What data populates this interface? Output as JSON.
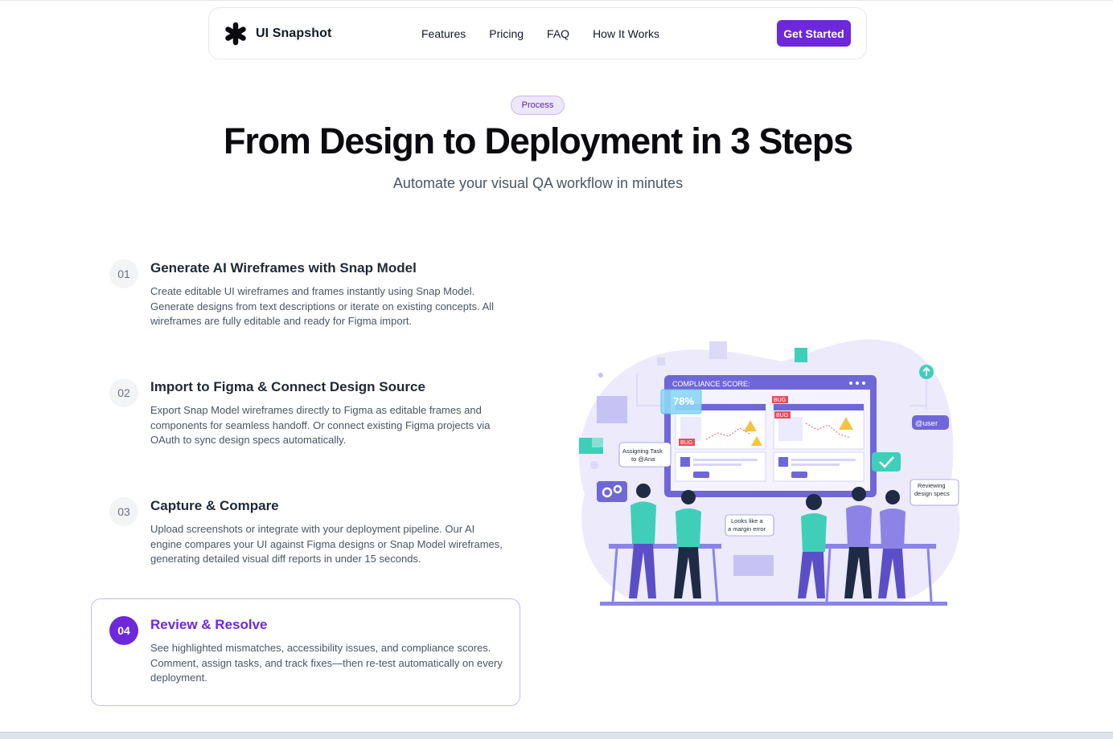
{
  "nav": {
    "brand": "UI Snapshot",
    "links": [
      "Features",
      "Pricing",
      "FAQ",
      "How It Works"
    ],
    "cta": "Get Started"
  },
  "hero": {
    "badge": "Process",
    "title": "From Design to Deployment in 3 Steps",
    "subtitle": "Automate your visual QA workflow in minutes"
  },
  "steps": [
    {
      "num": "01",
      "title": "Generate AI Wireframes with Snap Model",
      "desc": "Create editable UI wireframes and frames instantly using Snap Model. Generate designs from text descriptions or iterate on existing concepts. All wireframes are fully editable and ready for Figma import."
    },
    {
      "num": "02",
      "title": "Import to Figma & Connect Design Source",
      "desc": "Export Snap Model wireframes directly to Figma as editable frames and components for seamless handoff. Or connect existing Figma projects via OAuth to sync design specs automatically."
    },
    {
      "num": "03",
      "title": "Capture & Compare",
      "desc": "Upload screenshots or integrate with your deployment pipeline. Our AI engine compares your UI against Figma designs or Snap Model wireframes, generating detailed visual diff reports in under 15 seconds."
    },
    {
      "num": "04",
      "title": "Review & Resolve",
      "desc": "See highlighted mismatches, accessibility issues, and compliance scores. Comment, assign tasks, and track fixes—then re-test automatically on every deployment."
    }
  ],
  "illustration": {
    "compliance_label": "COMPLIANCE SCORE:",
    "score": "78%",
    "bug_label": "BUG",
    "bubble_assign": [
      "Assigning Task",
      "to @Ana"
    ],
    "bubble_margin": [
      "Looks like a",
      "a margin error"
    ],
    "bubble_review": [
      "Reviewing",
      "design specs"
    ],
    "bubble_user": "@user"
  },
  "colors": {
    "accent": "#6d28d9",
    "accent_light": "#ede7fb",
    "illustration_bg": "#e9e8fb",
    "screen_frame": "#6f67d8",
    "teal": "#3fcfb9"
  }
}
